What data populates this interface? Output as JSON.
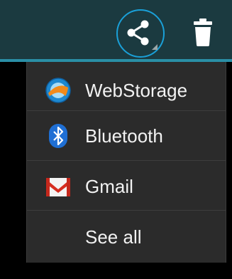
{
  "action_bar": {
    "share_icon": "share-icon",
    "trash_icon": "trash-icon",
    "accent_color": "#1aa0d8"
  },
  "share_menu": {
    "items": [
      {
        "label": "WebStorage",
        "icon": "webstorage-icon"
      },
      {
        "label": "Bluetooth",
        "icon": "bluetooth-icon"
      },
      {
        "label": "Gmail",
        "icon": "gmail-icon"
      },
      {
        "label": "See all",
        "icon": ""
      }
    ]
  }
}
